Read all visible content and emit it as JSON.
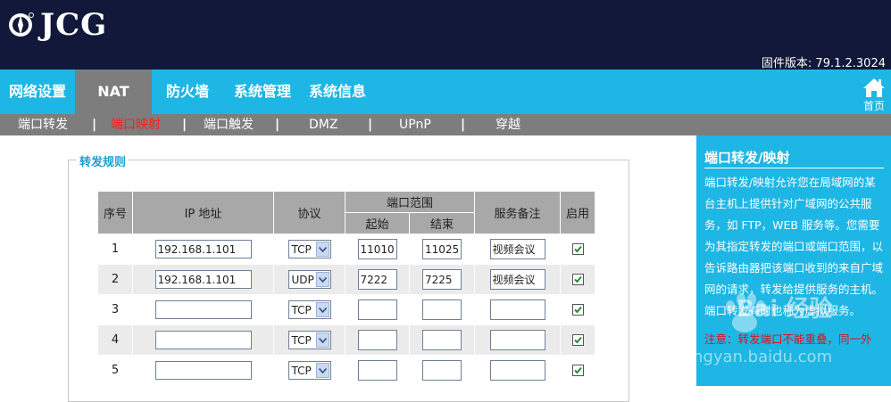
{
  "brand": {
    "logo_text": "JCG"
  },
  "firmware": "固件版本: 79.1.2.3024",
  "nav": {
    "items": [
      {
        "label": "网络设置"
      },
      {
        "label": "NAT"
      },
      {
        "label": "防火墙"
      },
      {
        "label": "系统管理"
      },
      {
        "label": "系统信息"
      }
    ],
    "active": "NAT",
    "home_label": "首页"
  },
  "subnav": {
    "items": [
      {
        "label": "端口转发"
      },
      {
        "label": "端口映射"
      },
      {
        "label": "端口触发"
      },
      {
        "label": "DMZ"
      },
      {
        "label": "UPnP"
      },
      {
        "label": "穿越"
      }
    ],
    "separator": "|",
    "active": "端口映射"
  },
  "rules": {
    "legend": "转发规则",
    "headers": {
      "index": "序号",
      "ip": "IP 地址",
      "protocol": "协议",
      "port_range": "端口范围",
      "start": "起始",
      "end": "结束",
      "note": "服务备注",
      "enable": "启用"
    },
    "rows": [
      {
        "index": "1",
        "ip": "192.168.1.101",
        "protocol": "TCP",
        "start": "11010",
        "end": "11025",
        "note": "视频会议",
        "enabled": true
      },
      {
        "index": "2",
        "ip": "192.168.1.101",
        "protocol": "UDP",
        "start": "7222",
        "end": "7225",
        "note": "视频会议",
        "enabled": true
      },
      {
        "index": "3",
        "ip": "",
        "protocol": "TCP",
        "start": "",
        "end": "",
        "note": "",
        "enabled": true
      },
      {
        "index": "4",
        "ip": "",
        "protocol": "TCP",
        "start": "",
        "end": "",
        "note": "",
        "enabled": true
      },
      {
        "index": "5",
        "ip": "",
        "protocol": "TCP",
        "start": "",
        "end": "",
        "note": "",
        "enabled": true
      }
    ]
  },
  "help": {
    "title": "端口转发/映射",
    "body": "端口转发/映射允许您在局域网的某台主机上提供针对广域网的公共服务，如 FTP，WEB 服务等。您需要为其指定转发的端口或端口范围，以告诉路由器把该端口收到的来自广域网的请求，转发给提供服务的主机。端口转发有时也称为虚拟服务。",
    "note": "注意：转发端口不能重叠，同一外"
  },
  "watermark": {
    "text": "Bai 经验",
    "url": "jingyan.baidu.com"
  },
  "colors": {
    "header_bg": "#12183a",
    "accent": "#1eb6e4",
    "active_tab": "#7d7d7d",
    "active_sub": "#ff2020",
    "check": "#2a8a2a"
  }
}
